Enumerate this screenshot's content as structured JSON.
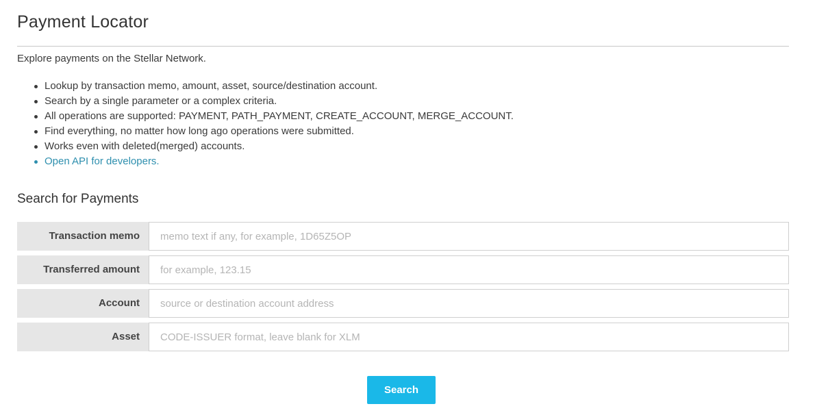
{
  "page": {
    "title": "Payment Locator",
    "intro": "Explore payments on the Stellar Network."
  },
  "features": [
    "Lookup by transaction memo, amount, asset, source/destination account.",
    "Search by a single parameter or a complex criteria.",
    "All operations are supported: PAYMENT, PATH_PAYMENT, CREATE_ACCOUNT, MERGE_ACCOUNT.",
    "Find everything, no matter how long ago operations were submitted.",
    "Works even with deleted(merged) accounts."
  ],
  "api_link": {
    "label": "Open API for developers."
  },
  "search": {
    "section_title": "Search for Payments",
    "fields": [
      {
        "label": "Transaction memo",
        "placeholder": "memo text if any, for example, 1D65Z5OP",
        "value": ""
      },
      {
        "label": "Transferred amount",
        "placeholder": "for example, 123.15",
        "value": ""
      },
      {
        "label": "Account",
        "placeholder": "source or destination account address",
        "value": ""
      },
      {
        "label": "Asset",
        "placeholder": "CODE-ISSUER format, leave blank for XLM",
        "value": ""
      }
    ],
    "button_label": "Search"
  },
  "colors": {
    "accent": "#1ab8e8",
    "link": "#2e8fae",
    "label_background": "#e6e6e6"
  }
}
